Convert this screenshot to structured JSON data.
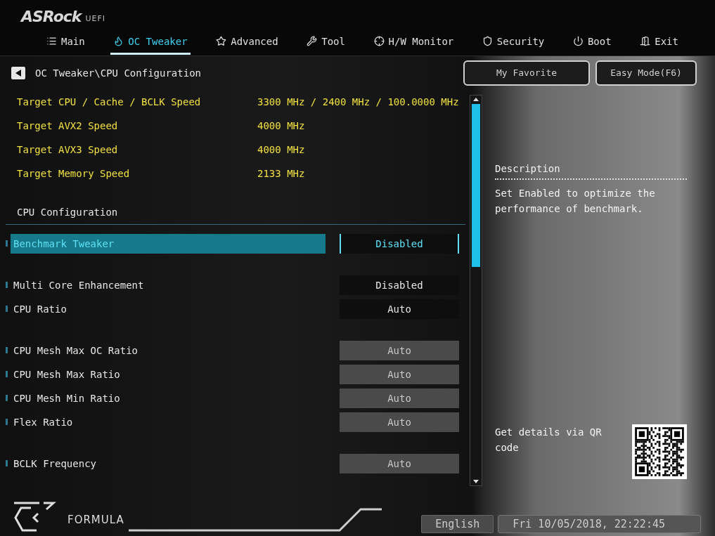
{
  "brand": {
    "logo": "ASRock",
    "suffix": "UEFI"
  },
  "tabs": [
    {
      "label": "Main",
      "selected": false
    },
    {
      "label": "OC Tweaker",
      "selected": true
    },
    {
      "label": "Advanced",
      "selected": false
    },
    {
      "label": "Tool",
      "selected": false
    },
    {
      "label": "H/W Monitor",
      "selected": false
    },
    {
      "label": "Security",
      "selected": false
    },
    {
      "label": "Boot",
      "selected": false
    },
    {
      "label": "Exit",
      "selected": false
    }
  ],
  "breadcrumb": "OC Tweaker\\CPU Configuration",
  "top_buttons": [
    "My Favorite",
    "Easy Mode(F6)"
  ],
  "info": [
    {
      "label": "Target CPU / Cache / BCLK Speed",
      "value": "3300 MHz / 2400 MHz / 100.0000 MHz"
    },
    {
      "label": "Target AVX2 Speed",
      "value": "4000 MHz"
    },
    {
      "label": "Target AVX3 Speed",
      "value": "4000 MHz"
    },
    {
      "label": "Target Memory Speed",
      "value": "2133 MHz"
    }
  ],
  "section_title": "CPU Configuration",
  "setting_groups": [
    [
      {
        "label": "Benchmark Tweaker",
        "value": "Disabled",
        "selected": true,
        "disabled": false
      }
    ],
    [
      {
        "label": "Multi Core Enhancement",
        "value": "Disabled",
        "selected": false,
        "disabled": false
      },
      {
        "label": "CPU Ratio",
        "value": "Auto",
        "selected": false,
        "disabled": false
      }
    ],
    [
      {
        "label": "CPU Mesh Max OC Ratio",
        "value": "Auto",
        "selected": false,
        "disabled": true
      },
      {
        "label": "CPU Mesh Max Ratio",
        "value": "Auto",
        "selected": false,
        "disabled": true
      },
      {
        "label": "CPU Mesh Min Ratio",
        "value": "Auto",
        "selected": false,
        "disabled": true
      },
      {
        "label": "Flex Ratio",
        "value": "Auto",
        "selected": false,
        "disabled": true
      }
    ],
    [
      {
        "label": "BCLK Frequency",
        "value": "Auto",
        "selected": false,
        "disabled": true
      }
    ]
  ],
  "description": {
    "title": "Description",
    "text": "Set Enabled to optimize the performance of benchmark."
  },
  "qr_text": "Get details via QR code",
  "footer": {
    "brand": "FORMULA",
    "language": "English",
    "datetime": "Fri 10/05/2018, 22:22:45"
  }
}
